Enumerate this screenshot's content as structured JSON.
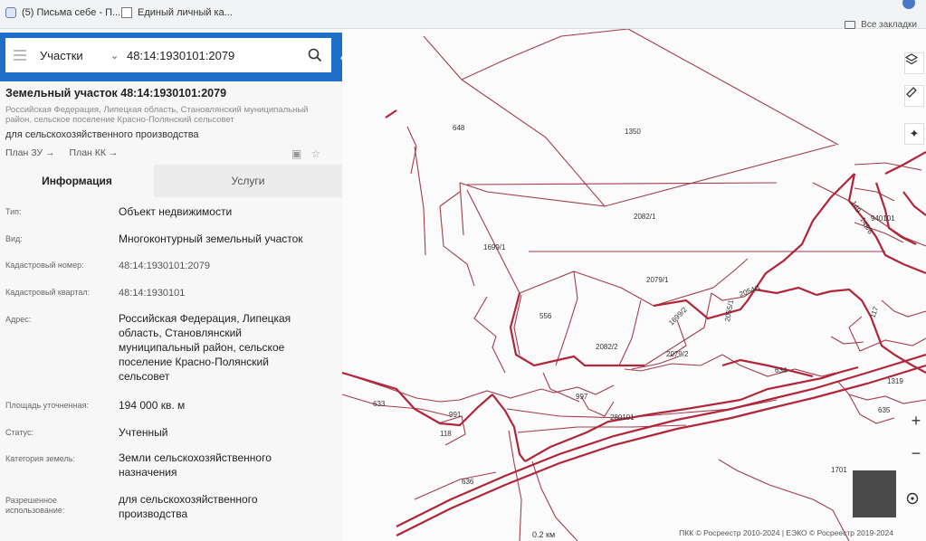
{
  "bookmarks": [
    {
      "label": "(5) Письма себе - П..."
    },
    {
      "label": "Единый личный ка..."
    }
  ],
  "bookmarks_folder": "Все закладки",
  "search": {
    "type_label": "Участки",
    "query": "48:14:1930101:2079"
  },
  "card": {
    "title": "Земельный участок 48:14:1930101:2079",
    "region": "Российская Федерация, Липецкая область, Становлянский муниципальный район, сельское поселение Красно-Полянский сельсовет",
    "purpose": "для сельскохозяйственного производства",
    "plan_zu": "План ЗУ →",
    "plan_kk": "План КК →"
  },
  "tabs": [
    {
      "label": "Информация"
    },
    {
      "label": "Услуги"
    }
  ],
  "info_rows": [
    {
      "label": "Тип:",
      "value": "Объект недвижимости"
    },
    {
      "label": "Вид:",
      "value": "Многоконтурный земельный участок"
    },
    {
      "label": "Кадастровый номер:",
      "value": "48:14:1930101:2079"
    },
    {
      "label": "Кадастровый квартал:",
      "value": "48:14:1930101"
    },
    {
      "label": "Адрес:",
      "value": "Российская Федерация, Липецкая область, Становлянский муниципальный район, сельское поселение Красно-Полянский сельсовет"
    },
    {
      "label": "Площадь уточненная:",
      "value": "194 000 кв. м"
    },
    {
      "label": "Статус:",
      "value": "Учтенный"
    },
    {
      "label": "Категория земель:",
      "value": "Земли сельскохозяйственного назначения"
    },
    {
      "label": "Разрешенное использование:",
      "value": "для сельскохозяйственного производства"
    }
  ],
  "map": {
    "parcel_labels": [
      "648",
      "1350",
      "2082/1",
      "1699/1",
      "2079/1",
      "556",
      "1699/2",
      "2055/1",
      "2054/1",
      "2082/2",
      "2079/2",
      "634",
      "1319",
      "997",
      "991",
      "633",
      "118",
      "280101",
      "635",
      "636",
      "1701",
      "149",
      "149/6",
      "940101",
      "117"
    ],
    "scale": "0.2 км",
    "copyright": "ПКК © Росреестр 2010-2024 | ЕЭКО © Росреестр 2019-2024"
  },
  "colors": {
    "accent": "#1e6fc7",
    "boundary_red": "#b0253a",
    "boundary_thin": "#a33c4b"
  }
}
